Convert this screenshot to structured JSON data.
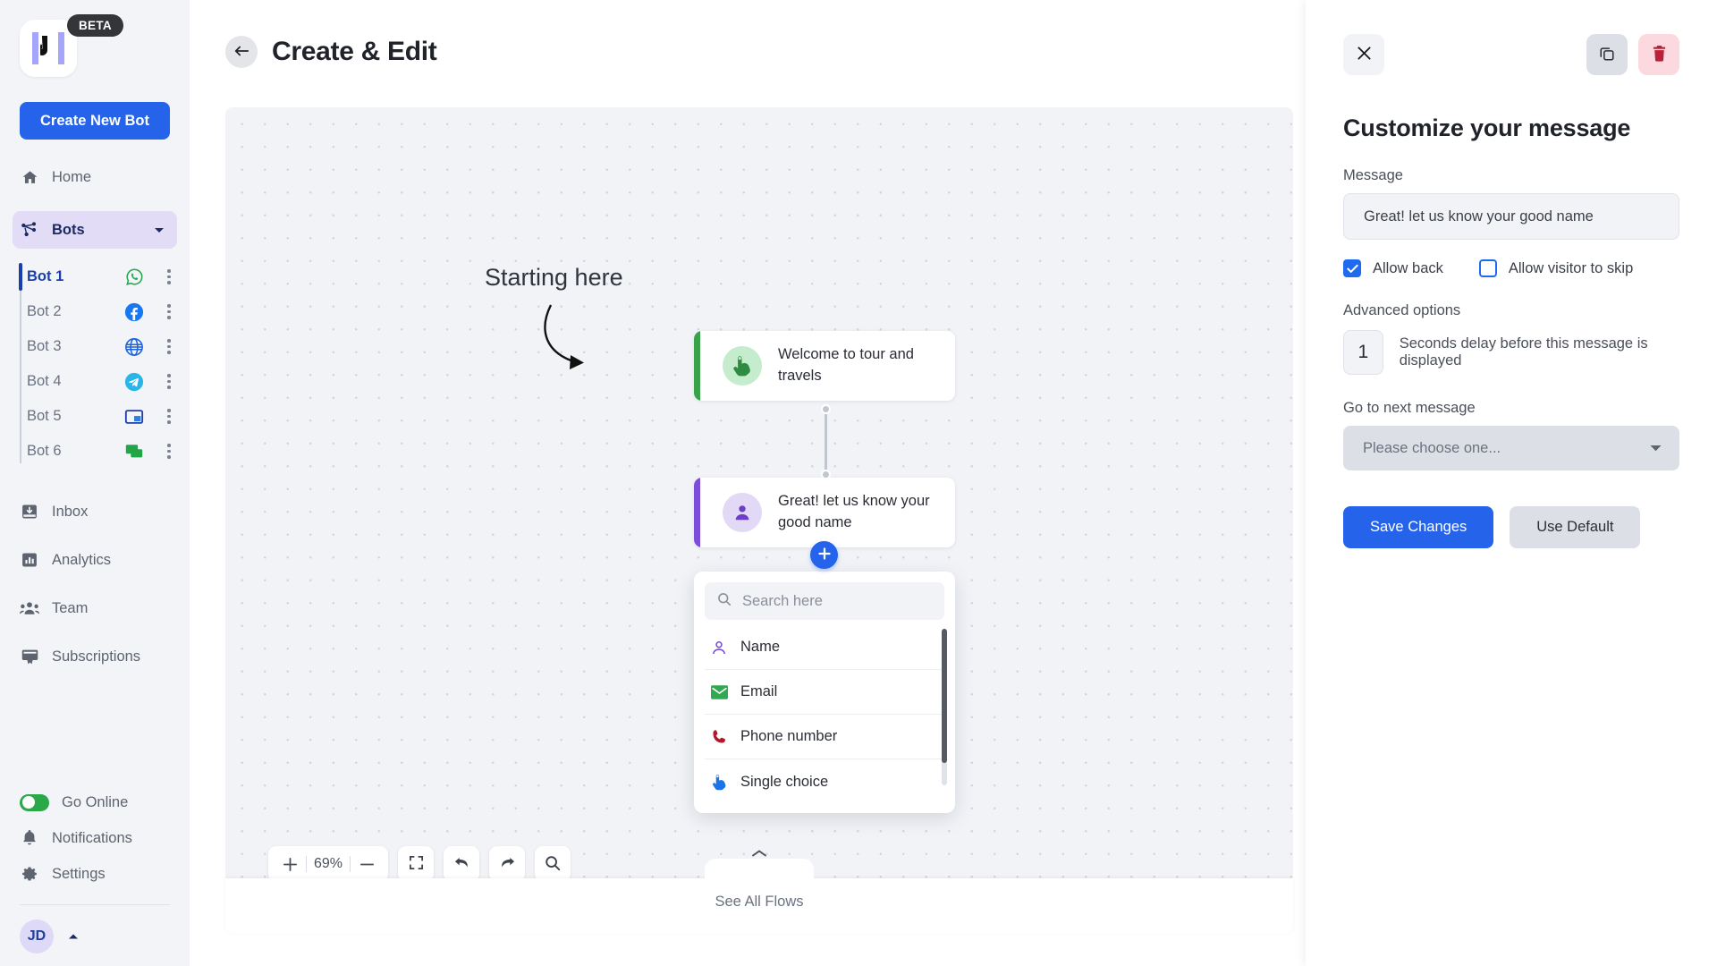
{
  "sidebar": {
    "logo_icon": "bot-logo-icon",
    "beta_badge": "BETA",
    "create_bot_label": "Create New Bot",
    "home": {
      "label": "Home",
      "icon": "home-icon"
    },
    "bots_group": {
      "label": "Bots",
      "icon": "bots-network-icon",
      "caret": "chevron-down-icon"
    },
    "bots": [
      {
        "name": "Bot 1",
        "channel": "whatsapp-icon",
        "active": true
      },
      {
        "name": "Bot 2",
        "channel": "facebook-icon",
        "active": false
      },
      {
        "name": "Bot 3",
        "channel": "website-globe-icon",
        "active": false
      },
      {
        "name": "Bot 4",
        "channel": "telegram-icon",
        "active": false
      },
      {
        "name": "Bot 5",
        "channel": "webpage-widget-icon",
        "active": false
      },
      {
        "name": "Bot 6",
        "channel": "sms-chat-icon",
        "active": false
      }
    ],
    "nav": [
      {
        "label": "Inbox",
        "icon": "inbox-icon"
      },
      {
        "label": "Analytics",
        "icon": "analytics-icon"
      },
      {
        "label": "Team",
        "icon": "team-icon"
      },
      {
        "label": "Subscriptions",
        "icon": "subscriptions-icon"
      }
    ],
    "go_online": {
      "label": "Go Online",
      "state": "on",
      "color": "#2aa84a"
    },
    "notifications": {
      "label": "Notifications",
      "icon": "bell-icon"
    },
    "settings": {
      "label": "Settings",
      "icon": "gear-icon"
    },
    "user": {
      "initials": "JD",
      "caret": "chevron-up-icon"
    }
  },
  "header": {
    "back_icon": "arrow-left-icon",
    "title": "Create & Edit"
  },
  "canvas": {
    "start_label": "Starting here",
    "nodes": [
      {
        "id": "welcome",
        "text": "Welcome to tour and travels",
        "stripe_color": "#3aa24a",
        "icon": "single-choice-tap-icon",
        "icon_bg": "#c6ecce",
        "icon_color": "#2e8b41"
      },
      {
        "id": "name",
        "text": "Great! let us know your good name",
        "stripe_color": "#7c4dd8",
        "icon": "person-icon",
        "icon_bg": "#e2d9f7",
        "icon_color": "#6d3fc9"
      }
    ],
    "add_button_icon": "plus-icon",
    "dropdown": {
      "search_placeholder": "Search here",
      "search_value": "",
      "search_icon": "search-icon",
      "items": [
        {
          "label": "Name",
          "icon": "person-outline-icon",
          "color": "#7c4dd8"
        },
        {
          "label": "Email",
          "icon": "email-icon",
          "color": "#33a852"
        },
        {
          "label": "Phone number",
          "icon": "phone-icon",
          "color": "#b3172c"
        },
        {
          "label": "Single choice",
          "icon": "tap-hand-icon",
          "color": "#1a73e8"
        }
      ]
    },
    "toolbar": {
      "zoom_in": "plus-icon",
      "zoom_level": "69%",
      "zoom_out": "minus-icon",
      "fit_screen": "fit-screen-icon",
      "undo": "undo-icon",
      "redo": "redo-icon",
      "search": "search-icon"
    },
    "flows_bar": {
      "label": "See All Flows",
      "chevron": "chevron-up-icon"
    }
  },
  "panel": {
    "close_icon": "close-icon",
    "copy_icon": "duplicate-icon",
    "delete_icon": "trash-icon",
    "title": "Customize your message",
    "message_label": "Message",
    "message_value": "Great! let us know your good name",
    "allow_back": {
      "label": "Allow back",
      "checked": true
    },
    "allow_skip": {
      "label": "Allow visitor to skip",
      "checked": false
    },
    "advanced_label": "Advanced options",
    "delay_value": "1",
    "delay_text": "Seconds delay before this message is displayed",
    "next_message_label": "Go to next message",
    "next_message_value": "Please choose one...",
    "next_message_caret": "caret-down-icon",
    "save_label": "Save Changes",
    "default_label": "Use Default"
  },
  "colors": {
    "accent": "#2563eb",
    "sidebar_bg": "#f2f4f7",
    "canvas_bg": "#f1f3f7",
    "active_bot": "#1b3faa",
    "danger": "#b9213b"
  }
}
